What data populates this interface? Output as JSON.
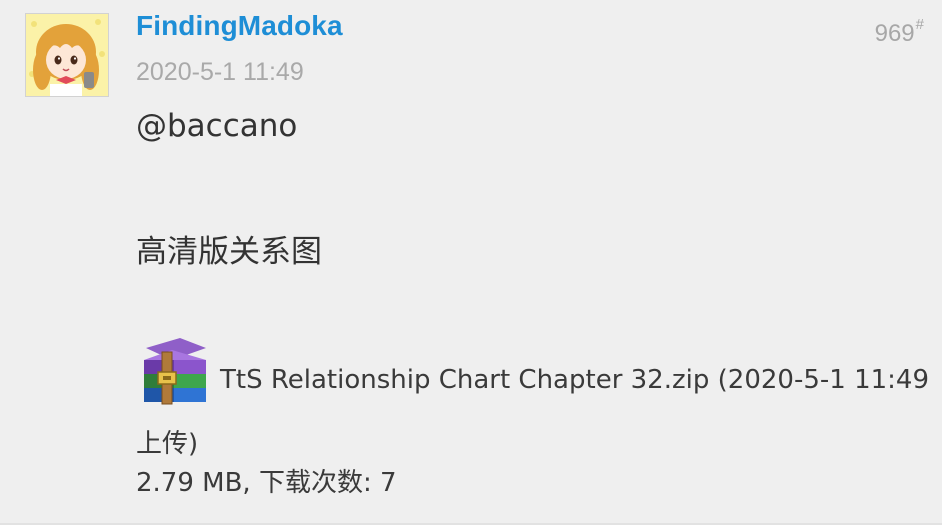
{
  "post": {
    "username": "FindingMadoka",
    "timestamp": "2020-5-1 11:49",
    "floor_number": "969",
    "floor_suffix": "#",
    "mention": "@baccano",
    "message": "高清版关系图"
  },
  "attachment": {
    "icon": "zip-archive-icon",
    "filename": "TtS Relationship Chart Chapter 32.zip",
    "upload_note": "(2020-5-1 11:49 上传)",
    "meta": "2.79 MB, 下载次数: 7"
  },
  "colors": {
    "username": "#1e8ed6",
    "muted": "#a9a9a9",
    "text": "#333333",
    "background": "#efefef"
  }
}
